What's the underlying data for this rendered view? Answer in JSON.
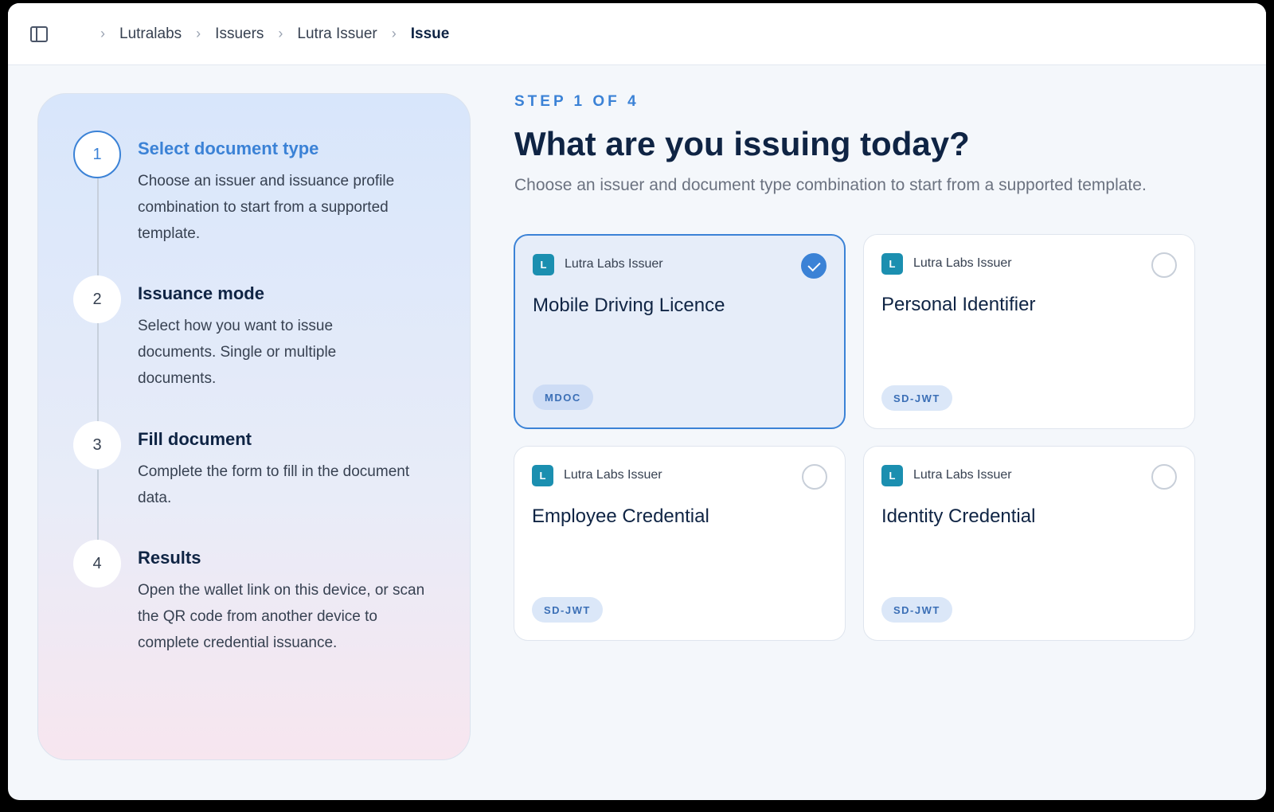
{
  "breadcrumb": [
    "Lutralabs",
    "Issuers",
    "Lutra Issuer",
    "Issue"
  ],
  "steps": [
    {
      "number": "1",
      "title": "Select document type",
      "description": "Choose an issuer and issuance profile combination to start from a supported template."
    },
    {
      "number": "2",
      "title": "Issuance mode",
      "description": "Select how you want to issue documents. Single or multiple documents."
    },
    {
      "number": "3",
      "title": "Fill document",
      "description": "Complete the form to fill in the document data."
    },
    {
      "number": "4",
      "title": "Results",
      "description": "Open the wallet link on this device, or scan the QR code from another device to complete credential issuance."
    }
  ],
  "main": {
    "step_label": "STEP 1 OF 4",
    "title": "What are you issuing today?",
    "subtitle": "Choose an issuer and document type combination to start from a supported template."
  },
  "cards": [
    {
      "logo": "L",
      "issuer": "Lutra Labs Issuer",
      "title": "Mobile Driving Licence",
      "badge": "MDOC",
      "selected": true
    },
    {
      "logo": "L",
      "issuer": "Lutra Labs Issuer",
      "title": "Personal Identifier",
      "badge": "SD-JWT",
      "selected": false
    },
    {
      "logo": "L",
      "issuer": "Lutra Labs Issuer",
      "title": "Employee Credential",
      "badge": "SD-JWT",
      "selected": false
    },
    {
      "logo": "L",
      "issuer": "Lutra Labs Issuer",
      "title": "Identity Credential",
      "badge": "SD-JWT",
      "selected": false
    }
  ],
  "colors": {
    "accent": "#3b82d6",
    "logo": "#1b8fb0",
    "text": "#0f2444"
  },
  "icons": {
    "sidebar_toggle": "sidebar-icon",
    "separator": "chevron-right-icon",
    "selected": "check-icon"
  }
}
